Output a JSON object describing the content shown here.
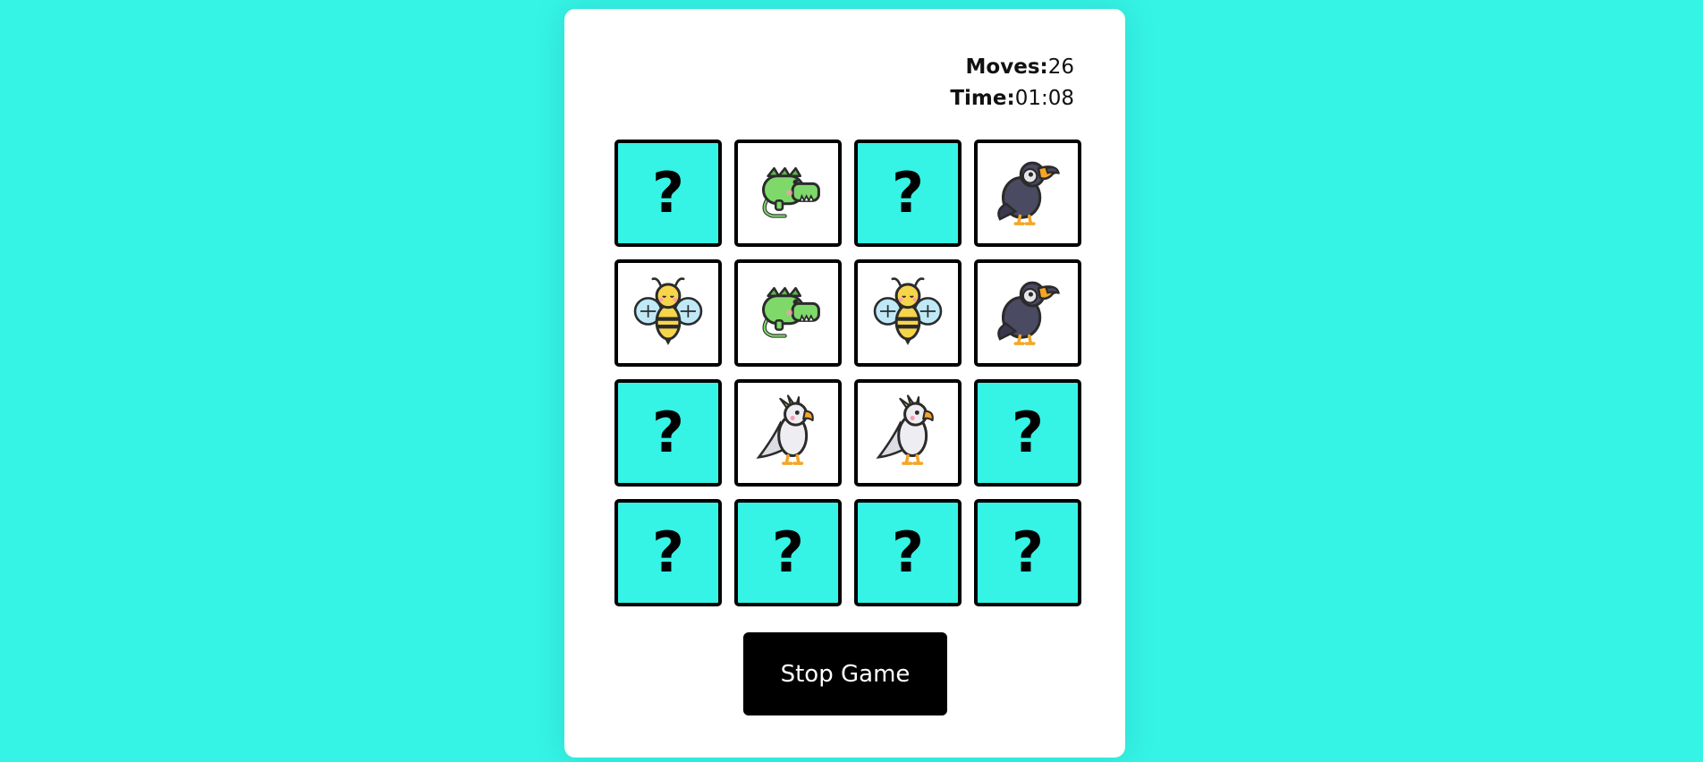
{
  "stats": {
    "moves_label": "Moves:",
    "moves_value": "26",
    "time_label": "Time:",
    "time_value": "01:08"
  },
  "cards": [
    {
      "state": "hidden",
      "symbol": "?"
    },
    {
      "state": "revealed",
      "animal": "crocodile"
    },
    {
      "state": "hidden",
      "symbol": "?"
    },
    {
      "state": "revealed",
      "animal": "toucan"
    },
    {
      "state": "revealed",
      "animal": "bee"
    },
    {
      "state": "revealed",
      "animal": "crocodile"
    },
    {
      "state": "revealed",
      "animal": "bee"
    },
    {
      "state": "revealed",
      "animal": "toucan"
    },
    {
      "state": "hidden",
      "symbol": "?"
    },
    {
      "state": "revealed",
      "animal": "cockatoo"
    },
    {
      "state": "revealed",
      "animal": "cockatoo"
    },
    {
      "state": "hidden",
      "symbol": "?"
    },
    {
      "state": "hidden",
      "symbol": "?"
    },
    {
      "state": "hidden",
      "symbol": "?"
    },
    {
      "state": "hidden",
      "symbol": "?"
    },
    {
      "state": "hidden",
      "symbol": "?"
    }
  ],
  "stop_button": "Stop Game",
  "colors": {
    "background": "#35f3e5",
    "card_hidden": "#35f3e5",
    "button": "#000000"
  }
}
